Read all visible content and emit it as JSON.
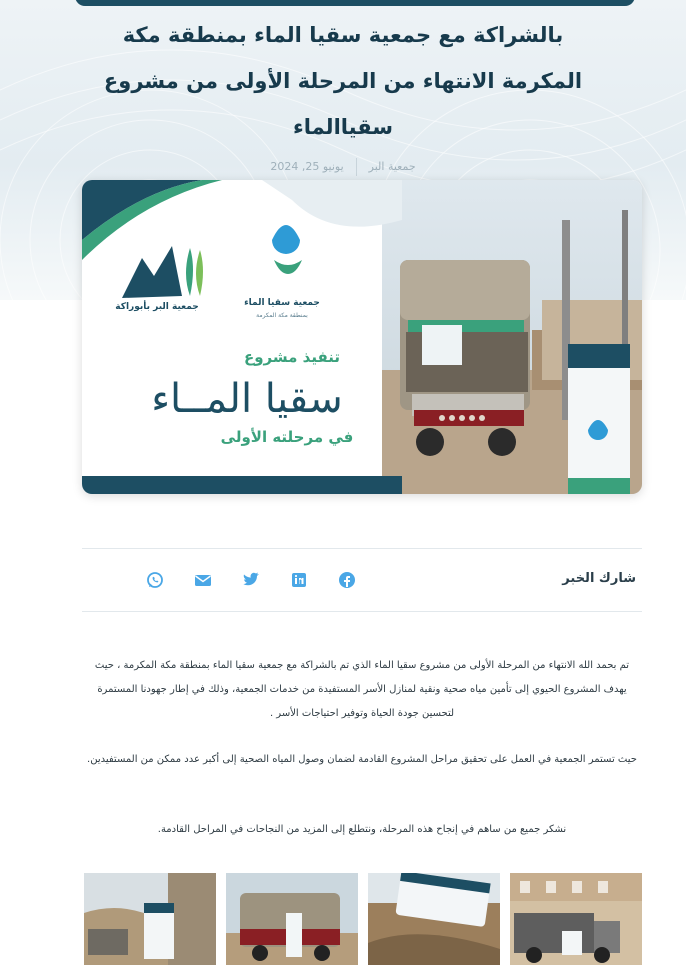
{
  "article": {
    "title_line1": "بالشراكة مع جمعية سقيا الماء بمنطقة مكة",
    "title_line2": "المكرمة الانتهاء من المرحلة الأولى من مشروع",
    "title_line3": "سقياالماء",
    "date": "يونيو 25, 2024",
    "author": "جمعية البر"
  },
  "banner": {
    "org_left": "جمعية البر بأبوراكة",
    "org_right": "جمعية سقيا الماء",
    "org_right_sub": "بمنطقة مكة المكرمة",
    "implement": "تنفيذ مشروع",
    "project": "سقيا المــاء",
    "phase": "في مرحلته الأولى"
  },
  "share": {
    "label": "شارك الخبر",
    "icons": [
      "facebook-icon",
      "linkedin-icon",
      "twitter-icon",
      "email-icon",
      "whatsapp-icon"
    ]
  },
  "body": {
    "p1": "تم بحمد الله الانتهاء من المرحلة الأولى من مشروع سقيا الماء الذي تم بالشراكة مع جمعية سقيا الماء بمنطقة مكة المكرمة ، حيث يهدف المشروع الحيوي إلى تأمين مياه صحية ونقية لمنازل الأسر المستفيدة من خدمات الجمعية، وذلك في إطار جهودنا المستمرة لتحسين جودة الحياة وتوفير احتياجات الأسر .",
    "p2": "حيث تستمر الجمعية في العمل على تحقيق مراحل المشروع القادمة لضمان وصول المياه الصحية إلى أكبر عدد ممكن من المستفيدين.",
    "p3": "نشكر جميع من ساهم في إنجاح هذه المرحلة، ونتطلع إلى المزيد من النجاحات في المراحل القادمة."
  },
  "colors": {
    "primary": "#1d4e63",
    "accent_green": "#3aa17c",
    "water_blue": "#2e9bd6",
    "text_dark": "#2d3a42",
    "meta_gray": "#9fb0ba"
  }
}
